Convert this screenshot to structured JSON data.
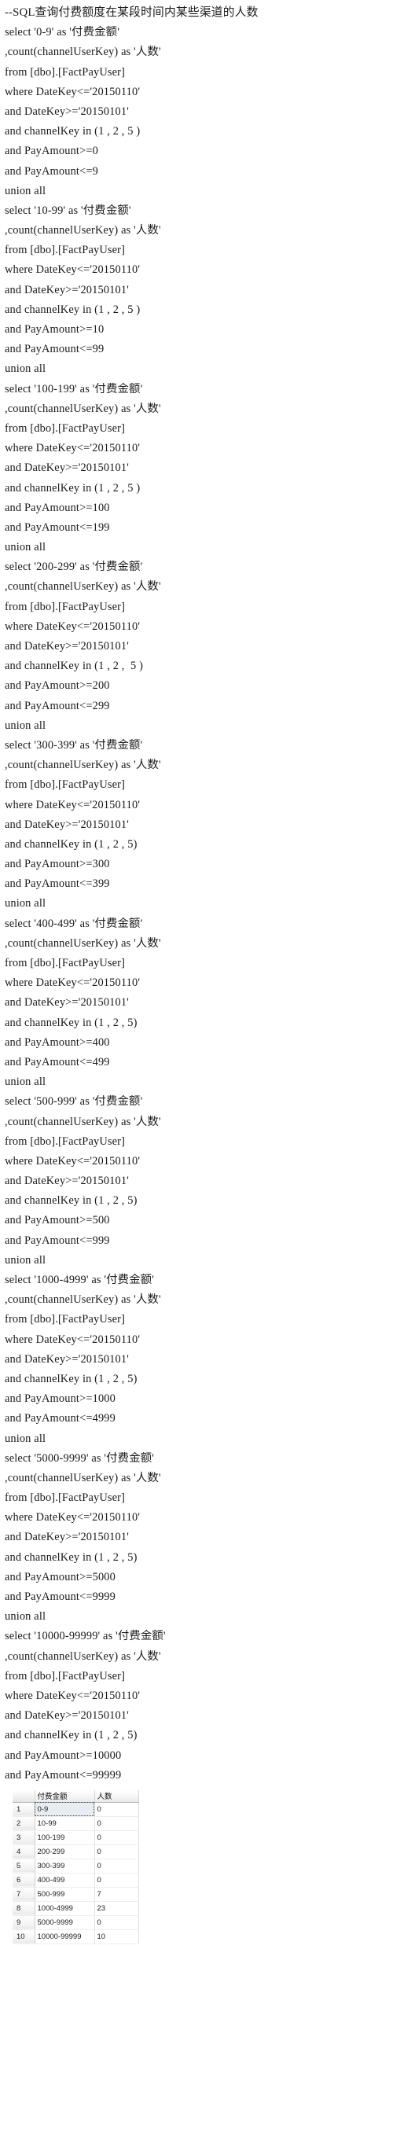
{
  "document": {
    "title_comment": "--SQL查询付费额度在某段时间内某些渠道的人数"
  },
  "sql": {
    "lines": [
      "--SQL查询付费额度在某段时间内某些渠道的人数",
      "select '0-9' as '付费金额'",
      ",count(channelUserKey) as '人数'",
      "from [dbo].[FactPayUser]",
      "where DateKey<='20150110'",
      "and DateKey>='20150101'",
      "and channelKey in (1 , 2 , 5 )",
      "and PayAmount>=0",
      "and PayAmount<=9",
      "union all",
      "select '10-99' as '付费金额'",
      ",count(channelUserKey) as '人数'",
      "from [dbo].[FactPayUser]",
      "where DateKey<='20150110'",
      "and DateKey>='20150101'",
      "and channelKey in (1 , 2 , 5 )",
      "and PayAmount>=10",
      "and PayAmount<=99",
      "union all",
      "select '100-199' as '付费金额'",
      ",count(channelUserKey) as '人数'",
      "from [dbo].[FactPayUser]",
      "where DateKey<='20150110'",
      "and DateKey>='20150101'",
      "and channelKey in (1 , 2 , 5 )",
      "and PayAmount>=100",
      "and PayAmount<=199",
      "union all",
      "select '200-299' as '付费金额'",
      ",count(channelUserKey) as '人数'",
      "from [dbo].[FactPayUser]",
      "where DateKey<='20150110'",
      "and DateKey>='20150101'",
      "and channelKey in (1 , 2 ,  5 )",
      "and PayAmount>=200",
      "and PayAmount<=299",
      "union all",
      "select '300-399' as '付费金额'",
      ",count(channelUserKey) as '人数'",
      "from [dbo].[FactPayUser]",
      "where DateKey<='20150110'",
      "and DateKey>='20150101'",
      "and channelKey in (1 , 2 , 5)",
      "and PayAmount>=300",
      "and PayAmount<=399",
      "union all",
      "select '400-499' as '付费金额'",
      ",count(channelUserKey) as '人数'",
      "from [dbo].[FactPayUser]",
      "where DateKey<='20150110'",
      "and DateKey>='20150101'",
      "and channelKey in (1 , 2 , 5)",
      "and PayAmount>=400",
      "and PayAmount<=499",
      "union all",
      "select '500-999' as '付费金额'",
      ",count(channelUserKey) as '人数'",
      "from [dbo].[FactPayUser]",
      "where DateKey<='20150110'",
      "and DateKey>='20150101'",
      "and channelKey in (1 , 2 , 5)",
      "and PayAmount>=500",
      "and PayAmount<=999",
      "union all",
      "select '1000-4999' as '付费金额'",
      ",count(channelUserKey) as '人数'",
      "from [dbo].[FactPayUser]",
      "where DateKey<='20150110'",
      "and DateKey>='20150101'",
      "and channelKey in (1 , 2 , 5)",
      "and PayAmount>=1000",
      "and PayAmount<=4999",
      "union all",
      "select '5000-9999' as '付费金额'",
      ",count(channelUserKey) as '人数'",
      "from [dbo].[FactPayUser]",
      "where DateKey<='20150110'",
      "and DateKey>='20150101'",
      "and channelKey in (1 , 2 , 5)",
      "and PayAmount>=5000",
      "and PayAmount<=9999",
      "union all",
      "select '10000-99999' as '付费金额'",
      ",count(channelUserKey) as '人数'",
      "from [dbo].[FactPayUser]",
      "where DateKey<='20150110'",
      "and DateKey>='20150101'",
      "and channelKey in (1 , 2 , 5)",
      "and PayAmount>=10000",
      "and PayAmount<=99999"
    ]
  },
  "result_grid": {
    "columns": [
      "",
      "付费金额",
      "人数"
    ],
    "selected_row_index": 0,
    "rows": [
      {
        "num": "1",
        "amount": "0-9",
        "count": "0"
      },
      {
        "num": "2",
        "amount": "10-99",
        "count": "0"
      },
      {
        "num": "3",
        "amount": "100-199",
        "count": "0"
      },
      {
        "num": "4",
        "amount": "200-299",
        "count": "0"
      },
      {
        "num": "5",
        "amount": "300-399",
        "count": "0"
      },
      {
        "num": "6",
        "amount": "400-499",
        "count": "0"
      },
      {
        "num": "7",
        "amount": "500-999",
        "count": "7"
      },
      {
        "num": "8",
        "amount": "1000-4999",
        "count": "23"
      },
      {
        "num": "9",
        "amount": "5000-9999",
        "count": "0"
      },
      {
        "num": "10",
        "amount": "10000-99999",
        "count": "10"
      }
    ]
  }
}
